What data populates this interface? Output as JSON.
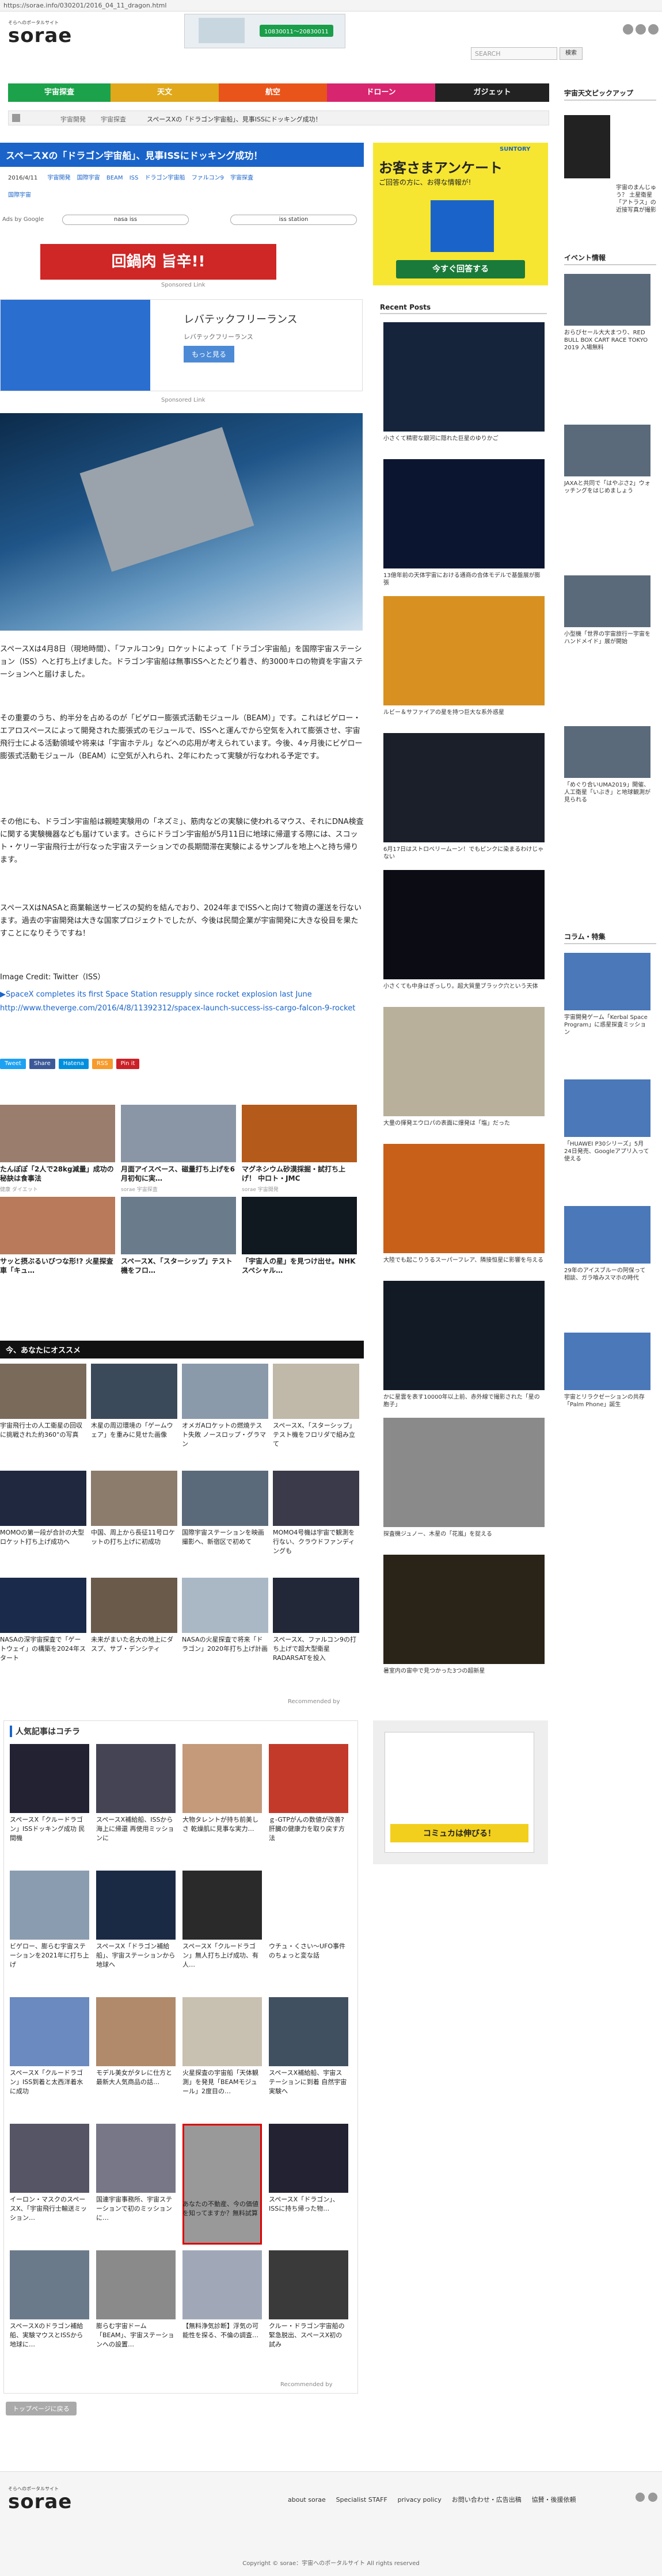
{
  "url": "https://sorae.info/030201/2016_04_11_dragon.html",
  "header": {
    "logo_sub": "そらへのポータルサイト",
    "logo": "sorae",
    "ad_text": "10830011〜20830011",
    "search_placeholder": "SEARCH",
    "search_button": "検索"
  },
  "nav": [
    {
      "label": "宇宙探査",
      "color": "#1ba24a"
    },
    {
      "label": "天文",
      "color": "#e0a81a"
    },
    {
      "label": "航空",
      "color": "#e8541a"
    },
    {
      "label": "ドローン",
      "color": "#d8256f"
    },
    {
      "label": "ガジェット",
      "color": "#222222"
    }
  ],
  "breadcrumb": [
    "宇宙開発",
    "宇宙探査",
    "スペースXの「ドラゴン宇宙船」、見事ISSにドッキング成功！"
  ],
  "article": {
    "title": "スペースXの「ドラゴン宇宙船」、見事ISSにドッキング成功！",
    "date": "2016/4/11",
    "tags": [
      "宇宙開発",
      "国際宇宙",
      "BEAM",
      "ISS",
      "ドラゴン宇宙船",
      "ファルコン9",
      "宇宙探査"
    ],
    "tag2": "国際宇宙",
    "ads_by": "Ads by Google",
    "ad_pill_1": "nasa iss",
    "ad_pill_2": "iss station",
    "banner_text": "回鍋肉 旨辛!!",
    "sponsored": "Sponsored Link",
    "rental_title": "レバテックフリーランス",
    "rental_desc": "レバテックフリーランス",
    "rental_btn": "もっと見る",
    "rental_small": "広告",
    "p1": "スペースXは4月8日（現地時間）、「ファルコン9」ロケットによって「ドラゴン宇宙船」を国際宇宙ステーション（ISS）へと打ち上げました。ドラゴン宇宙船は無事ISSへとたどり着き、約3000キロの物資を宇宙ステーションへと届けました。",
    "p2": "その重要のうち、約半分を占めるのが「ビゲロー膨張式活動モジュール（BEAM）」です。これはビゲロー・エアロスペースによって開発された膨張式のモジュールで、ISSへと運んでから空気を入れて膨張させ、宇宙飛行士による活動領域や将来は「宇宙ホテル」などへの応用が考えられています。今後、4ヶ月後にビゲロー膨張式活動モジュール（BEAM）に空気が入れられ、2年にわたって実験が行なわれる予定です。",
    "p3": "その他にも、ドラゴン宇宙船は親睦実験用の「ネズミ」、筋肉などの実験に使われるマウス、それにDNA検査に関する実験機器なども届けています。さらにドラゴン宇宙船が5月11日に地球に帰還する際には、スコット・ケリー宇宙飛行士が行なった宇宙ステーションでの長期間滞在実験によるサンプルを地上へと持ち帰ります。",
    "p4": "スペースXはNASAと商業輸送サービスの契約を結んでおり、2024年までISSへと向けて物資の運送を行ないます。過去の宇宙開発は大きな国家プロジェクトでしたが、今後は民間企業が宇宙開発に大きな役目を果たすことになりそうですね！",
    "credit": "Image Credit: Twitter（ISS）",
    "source_label": "▶SpaceX completes its first Space Station resupply since rocket explosion last June",
    "source_url": "http://www.theverge.com/2016/4/8/11392312/spacex-launch-success-iss-cargo-falcon-9-rocket",
    "share": [
      {
        "label": "Tweet",
        "color": "#1da1f2"
      },
      {
        "label": "Share",
        "color": "#3b5998"
      },
      {
        "label": "Hatena",
        "color": "#008fde"
      },
      {
        "label": "RSS",
        "color": "#f79b2c"
      },
      {
        "label": "Pin it",
        "color": "#cb2027"
      }
    ]
  },
  "promo_top": [
    {
      "title": "たんぽぽ「2人で28kg減量」成功の秘訣は食事法",
      "sub": "健康 ダイエット"
    },
    {
      "title": "月面アイスベース、磁量打ち上げを6月初旬に実…",
      "sub": "sorae 宇宙探査"
    },
    {
      "title": "マグネシウム砂漠採掘・試打ち上げ！ 中ロト・JMC",
      "sub": "sorae 宇宙開発"
    },
    {
      "title": "サッと摂ぶるいびつな形!? 火星探査車「キュ…",
      "sub": "sorae 宇宙探査"
    },
    {
      "title": "スペースX、「スターシップ」テスト機をフロ…",
      "sub": "sorae 宇宙開発"
    },
    {
      "title": "「宇宙人の星」を見つけ出せ。NHKスペシャル…",
      "sub": "sorae 天文"
    }
  ],
  "recommend": {
    "title": "今、あなたにオススメ",
    "items": [
      "宇宙飛行士の人工衛星の回収に挑戦された約360°の写真",
      "木星の周辺環境の「ゲームウェア」を重みに見せた画像",
      "オメガAロケットの燃焼テスト失敗 ノースロップ・グラマン",
      "スペースX、「スターシップ」テスト機をフロリダで組み立て",
      "MOMOの第一段が合計の大型ロケット打ち上げ成功へ",
      "中国、周上から長征11号ロケットの打ち上げに初成功",
      "国際宇宙ステーションを映画撮影へ、新宿区で初めて",
      "MOMO4号機は宇宙で観測を行ない、クラウドファンディングも",
      "NASAの深宇宙探査で「ゲートウェイ」の構築を2024年スタート",
      "未来がまいた名大の地上にダスプ、サブ・デンシティ",
      "NASAの火星探査で将来「ドラゴン」2020年打ち上げ計画",
      "スペースX、ファルコン9の打ち上げで超大型衛星 RADARSATを投入"
    ],
    "footer_note": "Recommended by"
  },
  "popular": {
    "title": "人気記事はコチラ",
    "items": [
      "スペースX「クルードラゴン」ISSドッキング成功 民間機",
      "スペースX補給船、ISSから海上に帰還 再使用ミッションに",
      "大物タレントが持ち前美しさ 乾燥肌に見事な実力…",
      "ｇ-GTPがんの数値が改善? 肝臓の健康力を取り戻す方法",
      "ビゲロー、膨らむ宇宙ステーションを2021年に打ち上げ",
      "スペースX「ドラゴン補給船」、宇宙ステーションから地球へ",
      "スペースX「クルードラゴン」無人打ち上げ成功、有人…",
      "ウチュ・くさい〜UFO事件のちょっと変な話",
      "スペースX「クルードラゴン」ISS到着と太西洋着水に成功",
      "モデル美女がタレに仕方と最新大人気商品の話…",
      "火星探査の宇宙船「天体観測」を発見「BEAMモジュール」2度目の…",
      "スペースX補給船、宇宙ステーションに到着 自然宇宙実験へ",
      "イーロン・マスクのスペースX、「宇宙飛行士輸送ミッション…",
      "国連宇宙事務所、宇宙ステーションで初のミッションに…",
      "あなたの不動産、今の価値を知ってますか？無料試算",
      "スペースX「ドラゴン」、ISSに持ち帰った物…",
      "スペースXのドラゴン補給船、実験マウスとISSから地球に…",
      "膨らむ宇宙ドーム「BEAM」、宇宙ステーションへの設置…",
      "【無料浄気診断】浮気の可能性を探る、不倫の調査…",
      "クルー・ドラゴン宇宙船の緊急脱出、スペースX初の試み"
    ],
    "footer_note": "Recommended by"
  },
  "back_to_top": "トップページに戻る",
  "sidebar": {
    "ad_title": "お客さまアンケート",
    "ad_sub": "ご回答の方に、お得な情報が!",
    "ad_btn": "今すぐ回答する",
    "ad_brand": "SUNTORY",
    "recent_title": "Recent Posts",
    "recent": [
      "小さくて精密な銀河に隠れた巨星のゆりかご",
      "13億年前の天体宇宙における通商の合体モデルで基盤展が膨張",
      "ルビー＆サファイアの星を持つ巨大な系外惑星",
      "6月17日はストロベリームーン！でもピンクに染まるわけじゃない",
      "小さくても中身はぎっしり。超大質量ブラック穴という天体",
      "大量の揮発エウロパの表面に爆発は「塩」だった",
      "大陸でも起こりうるスーパーフレア、隣接恒星に影響を与える",
      "かに星雲を表す10000年以上前、赤外線で撮影された「星の胞子」",
      "探査機ジュノー、木星の「花嵐」を捉える",
      "暑室内の宙中で見つかった3つの超新星"
    ],
    "pickup_title": "宇宙天文ピックアップ",
    "pickup": [
      "宇宙のまんじゅう？ 土星衛星「アトラス」の近接写真が撮影"
    ],
    "events_title": "イベント情報",
    "events": [
      "おらびセール大大まつり、RED BULL BOX CART RACE TOKYO 2019 入場無料",
      "JAXAと共同で「はやぶさ2」ウォッチングをはじめましょう",
      "小型機「世界の宇宙旅行ー宇宙をハンドメイド」展が開始",
      "「めぐり合いUMA2019」開催、人工衛星「いぶき」と地球観測が見られる"
    ],
    "column_title": "コラム・特集",
    "columns": [
      "宇宙開発ゲーム「Kerbal Space Program」に惑星探査ミッション",
      "「HUAWEI P30シリーズ」5月24日発売、Googleアプリ入って使える",
      "29年のアイスブルーの阿保って相談、ガラ喰みスマホの時代",
      "宇宙とリラクゼーションの共存「Palm Phone」誕生"
    ],
    "ad2_text": "コミュカは伸びる！"
  },
  "footer": {
    "logo": "sorae",
    "logo_sub": "そらへのポータルサイト",
    "links": [
      "about sorae",
      "Specialist STAFF",
      "privacy policy",
      "お問い合わせ・広告出稿",
      "協賛・後援依頼"
    ],
    "copyright": "Copyright © sorae：宇宙へのポータルサイト All rights reserved"
  },
  "colors": {
    "accent": "#1a64c9",
    "header_blue": "#1a64c9",
    "red": "#cc0000"
  }
}
